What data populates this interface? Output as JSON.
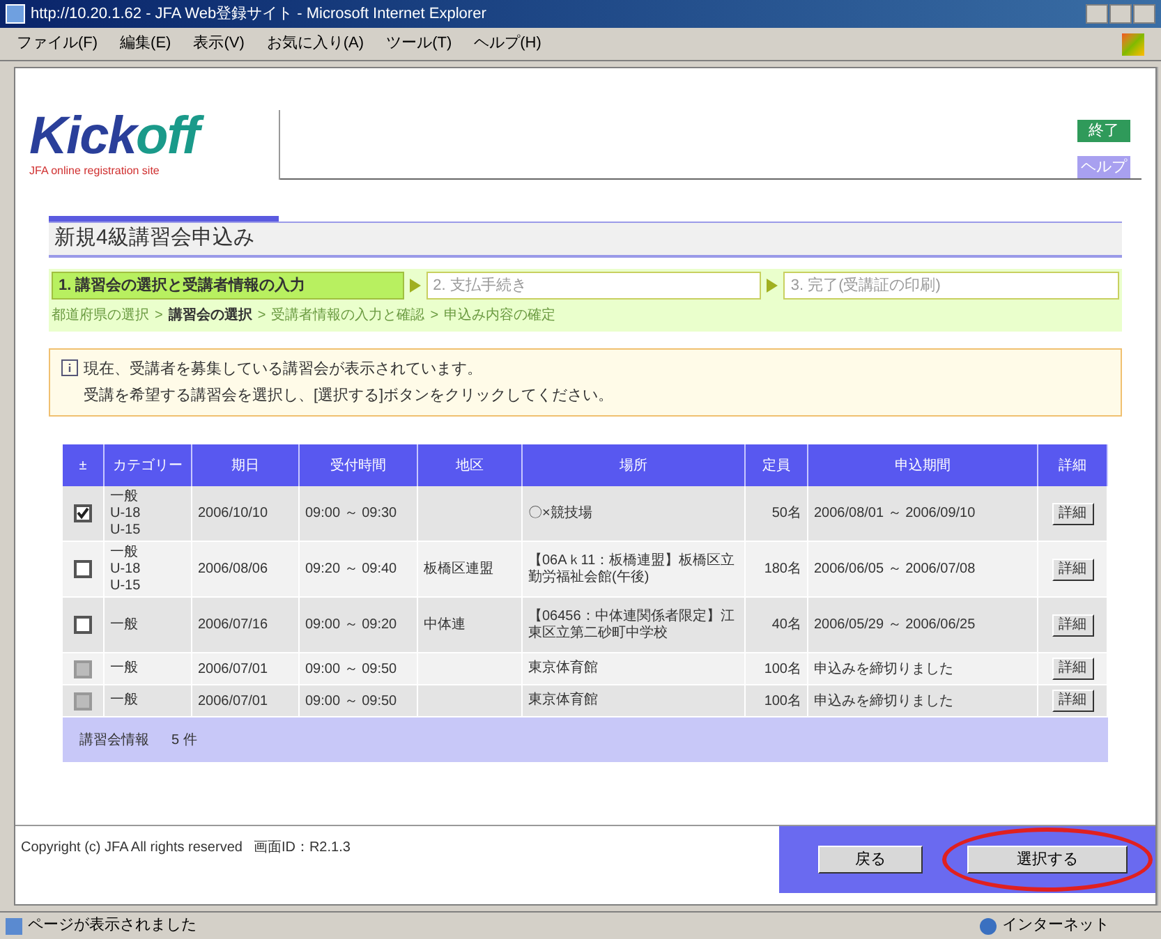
{
  "window": {
    "title": "http://10.20.1.62 - JFA Web登録サイト - Microsoft Internet Explorer"
  },
  "menu": [
    "ファイル(F)",
    "編集(E)",
    "表示(V)",
    "お気に入り(A)",
    "ツール(T)",
    "ヘルプ(H)"
  ],
  "logo": {
    "main": "Kick",
    "accent": "off",
    "tagline": "JFA online registration site"
  },
  "header_buttons": [
    {
      "label": "終了",
      "kind": "exit"
    },
    {
      "label": "ヘルプ",
      "kind": "help"
    }
  ],
  "page_title": "新規4級講習会申込み",
  "steps": [
    {
      "label": "1. 講習会の選択と受講者情報の入力",
      "active": true
    },
    {
      "label": "2. 支払手続き",
      "active": false
    },
    {
      "label": "3. 完了(受講証の印刷)",
      "active": false
    }
  ],
  "breadcrumb": [
    {
      "label": "都道府県の選択",
      "current": false
    },
    {
      "separator": ">",
      "label": "講習会の選択",
      "current": true
    },
    {
      "separator": ">",
      "label": "受講者情報の入力と確認",
      "current": false
    },
    {
      "separator": ">",
      "label": "申込み内容の確定",
      "current": false
    }
  ],
  "notice": {
    "lines": [
      "現在、受講者を募集している講習会が表示されています。",
      "受講を希望する講習会を選択し、[選択する]ボタンをクリックしてください。"
    ]
  },
  "table": {
    "columns": [
      "±",
      "カテゴリー",
      "期日",
      "受付時間",
      "地区",
      "場所",
      "定員",
      "申込期間",
      "詳細"
    ],
    "rows": [
      {
        "checked": true,
        "disabled": false,
        "category": [
          "一般",
          "U-18",
          "U-15"
        ],
        "date": "2006/10/10",
        "time": "09:00 ～ 09:30",
        "region": "",
        "venue": "〇×競技場",
        "capacity": "50名",
        "period": "2006/08/01 ～ 2006/09/10",
        "detail": "詳細"
      },
      {
        "checked": false,
        "disabled": false,
        "category": [
          "一般",
          "U-18",
          "U-15"
        ],
        "date": "2006/08/06",
        "time": "09:20 ～ 09:40",
        "region": "板橋区連盟",
        "venue": "【06Aｋ11：板橋連盟】板橋区立勤労福祉会館(午後)",
        "capacity": "180名",
        "period": "2006/06/05 ～ 2006/07/08",
        "detail": "詳細"
      },
      {
        "checked": false,
        "disabled": false,
        "category": [
          "一般"
        ],
        "date": "2006/07/16",
        "time": "09:00 ～ 09:20",
        "region": "中体連",
        "venue": "【06456：中体連関係者限定】江東区立第二砂町中学校",
        "capacity": "40名",
        "period": "2006/05/29 ～ 2006/06/25",
        "detail": "詳細"
      },
      {
        "checked": false,
        "disabled": true,
        "category": [
          "一般"
        ],
        "date": "2006/07/01",
        "time": "09:00 ～ 09:50",
        "region": "",
        "venue": "東京体育館",
        "capacity": "100名",
        "period": "申込みを締切りました",
        "detail": "詳細"
      },
      {
        "checked": false,
        "disabled": true,
        "category": [
          "一般"
        ],
        "date": "2006/07/01",
        "time": "09:00 ～ 09:50",
        "region": "",
        "venue": "東京体育館",
        "capacity": "100名",
        "period": "申込みを締切りました",
        "detail": "詳細"
      }
    ],
    "summary": {
      "label": "講習会情報",
      "count": "5 件"
    }
  },
  "footer": {
    "copyright": "Copyright (c) JFA All rights reserved",
    "screen_id": "画面ID：R2.1.3"
  },
  "actions": [
    {
      "label": "戻る",
      "highlighted": false
    },
    {
      "label": "選択する",
      "highlighted": true
    }
  ],
  "status_bar": {
    "message": "ページが表示されました",
    "zone": "インターネット"
  }
}
